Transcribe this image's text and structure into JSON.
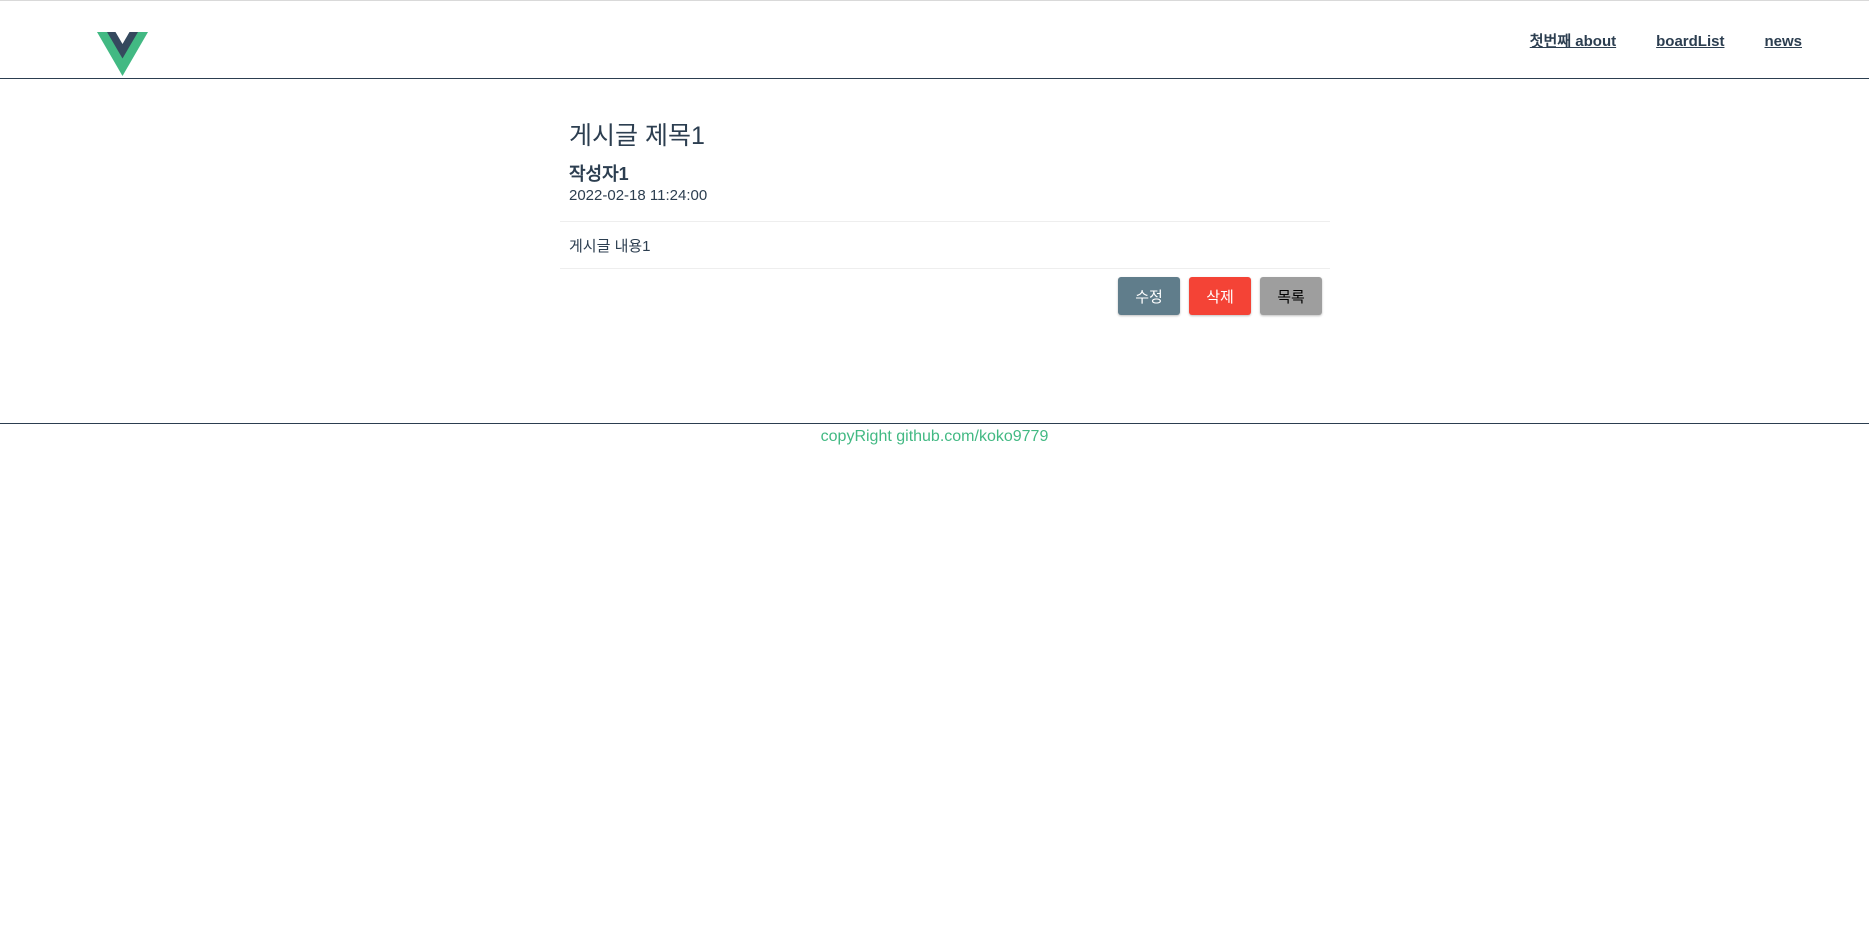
{
  "header": {
    "logo_icon": "vue-logo-icon",
    "nav": [
      {
        "label": "첫번째 about"
      },
      {
        "label": "boardList"
      },
      {
        "label": "news"
      }
    ]
  },
  "board": {
    "title": "게시글 제목1",
    "writer": "작성자1",
    "date": "2022-02-18 11:24:00",
    "content": "게시글 내용1",
    "buttons": {
      "edit": "수정",
      "delete": "삭제",
      "list": "목록"
    }
  },
  "footer": {
    "text": "copyRight github.com/koko9779"
  },
  "colors": {
    "vue_green": "#42b983",
    "vue_dark": "#35495e",
    "text": "#2c3e50",
    "edit_button": "#607d8b",
    "delete_button": "#f44336",
    "list_button": "#9e9e9e"
  }
}
